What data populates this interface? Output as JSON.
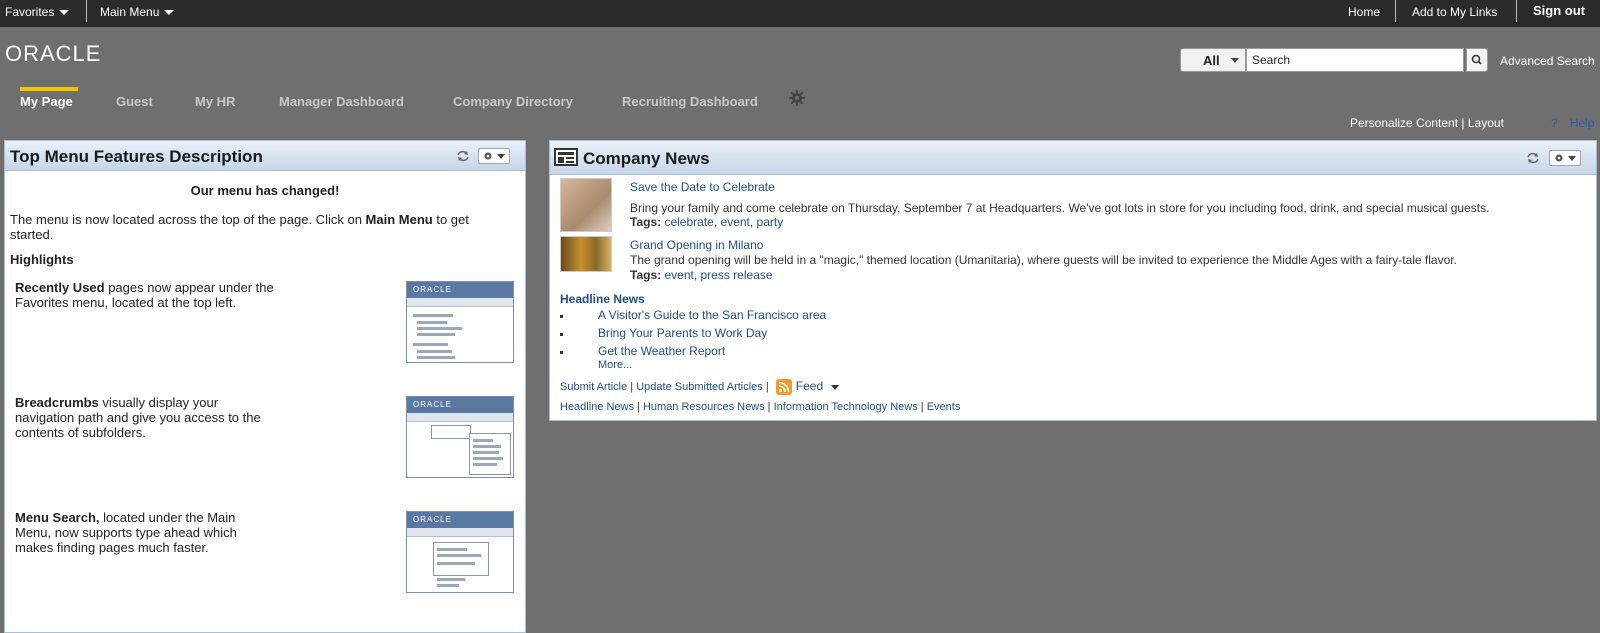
{
  "topbar": {
    "favorites": "Favorites",
    "main_menu": "Main Menu",
    "home": "Home",
    "add_links": "Add to My Links",
    "sign_out": "Sign out"
  },
  "header": {
    "logo": "ORACLE",
    "search_scope": "All",
    "search_value": "Search",
    "advanced_search": "Advanced Search"
  },
  "nav": {
    "tabs": [
      {
        "label": "My Page",
        "active": true
      },
      {
        "label": "Guest"
      },
      {
        "label": "My HR"
      },
      {
        "label": "Manager Dashboard"
      },
      {
        "label": "Company Directory"
      },
      {
        "label": "Recruiting Dashboard"
      }
    ]
  },
  "page_links": {
    "personalize": "Personalize Content",
    "sep": " | ",
    "layout": "Layout",
    "help": "Help"
  },
  "features_pod": {
    "title": "Top Menu Features Description",
    "changed": "Our menu has changed!",
    "intro_pre": "The menu is now located across the top of the page. Click on ",
    "intro_bold": "Main Menu",
    "intro_post": " to get started.",
    "highlights": "Highlights",
    "features": [
      {
        "bold": "Recently Used",
        "text": " pages now appear under the Favorites menu, located at the top left."
      },
      {
        "bold": "Breadcrumbs",
        "text": " visually display your navigation path and give you access to the contents of subfolders."
      },
      {
        "bold": "Menu Search,",
        "text": " located under the Main Menu, now supports type ahead which makes finding pages much faster."
      }
    ]
  },
  "news_pod": {
    "title": "Company News",
    "items": [
      {
        "title": "Save the Date to Celebrate",
        "body": "Bring your family and come celebrate on Thursday, September 7 at Headquarters. We've got lots in store for you including food, drink, and special musical guests.",
        "tags_label": "Tags:",
        "tags": [
          "celebrate",
          "event",
          "party"
        ]
      },
      {
        "title": "Grand Opening in Milano",
        "body": "The grand opening will be held in a \"magic,\" themed location (Umanitaria), where guests will be invited to experience the Middle Ages with a fairy-tale flavor.",
        "tags_label": "Tags:",
        "tags": [
          "event",
          "press release"
        ]
      }
    ],
    "headline_title": "Headline News",
    "headlines": [
      "A Visitor's Guide to the San Francisco area",
      "Bring Your Parents to Work Day",
      "Get the Weather Report"
    ],
    "more": "More...",
    "actions": {
      "submit": "Submit Article",
      "update": "Update Submitted Articles",
      "feed": "Feed"
    },
    "categories": [
      "Headline News",
      "Human Resources News",
      "Information Technology News",
      "Events"
    ]
  },
  "colors": {
    "link": "#1f4e8c",
    "active_tab_indicator": "#f5c400",
    "topbar": "#2b2b2b",
    "background": "#6f6f6f"
  }
}
